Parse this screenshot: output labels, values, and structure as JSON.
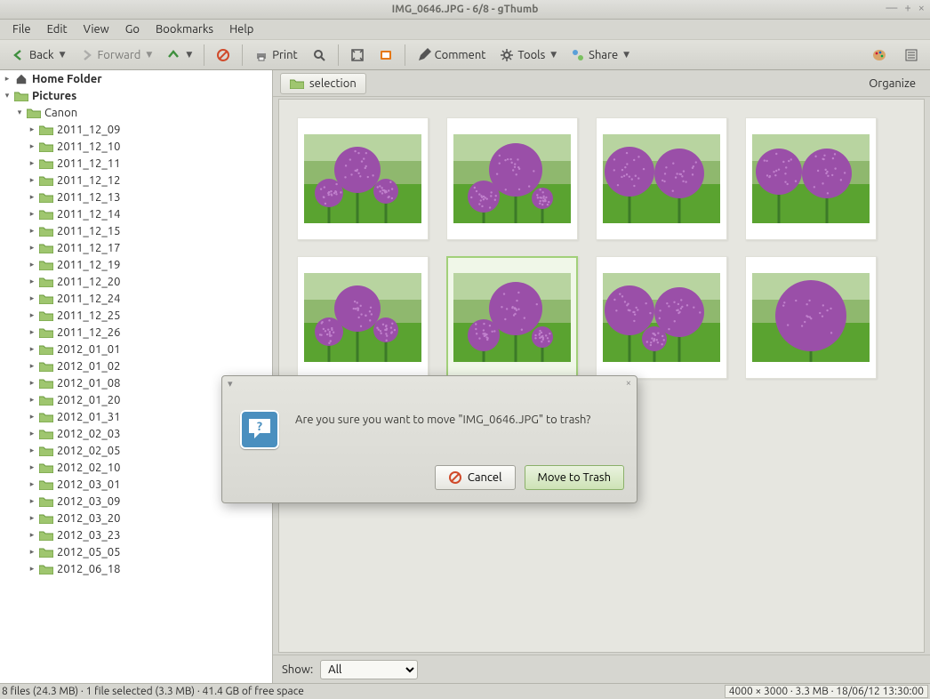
{
  "window": {
    "title": "IMG_0646.JPG - 6/8 - gThumb",
    "min": "—",
    "max": "+",
    "close": "×"
  },
  "menu": [
    "File",
    "Edit",
    "View",
    "Go",
    "Bookmarks",
    "Help"
  ],
  "toolbar": {
    "back": "Back",
    "forward": "Forward",
    "print": "Print",
    "comment": "Comment",
    "tools": "Tools",
    "share": "Share"
  },
  "tree": {
    "home": "Home Folder",
    "pictures": "Pictures",
    "canon": "Canon",
    "folders": [
      "2011_12_09",
      "2011_12_10",
      "2011_12_11",
      "2011_12_12",
      "2011_12_13",
      "2011_12_14",
      "2011_12_15",
      "2011_12_17",
      "2011_12_19",
      "2011_12_20",
      "2011_12_24",
      "2011_12_25",
      "2011_12_26",
      "2012_01_01",
      "2012_01_02",
      "2012_01_08",
      "2012_01_20",
      "2012_01_31",
      "2012_02_03",
      "2012_02_05",
      "2012_02_10",
      "2012_03_01",
      "2012_03_09",
      "2012_03_20",
      "2012_03_23",
      "2012_05_05",
      "2012_06_18"
    ]
  },
  "breadcrumb": {
    "label": "selection"
  },
  "organize": "Organize",
  "thumbs": {
    "selected_index": 5
  },
  "showbar": {
    "label": "Show:",
    "value": "All"
  },
  "status": {
    "left": "8 files (24.3 MB) · 1 file selected (3.3 MB) · 41.4 GB of free space",
    "right": "4000 × 3000 · 3.3 MB · 18/06/12 13:30:00"
  },
  "dialog": {
    "message": "Are you sure you want to move \"IMG_0646.JPG\" to trash?",
    "cancel": "Cancel",
    "confirm": "Move to Trash"
  }
}
